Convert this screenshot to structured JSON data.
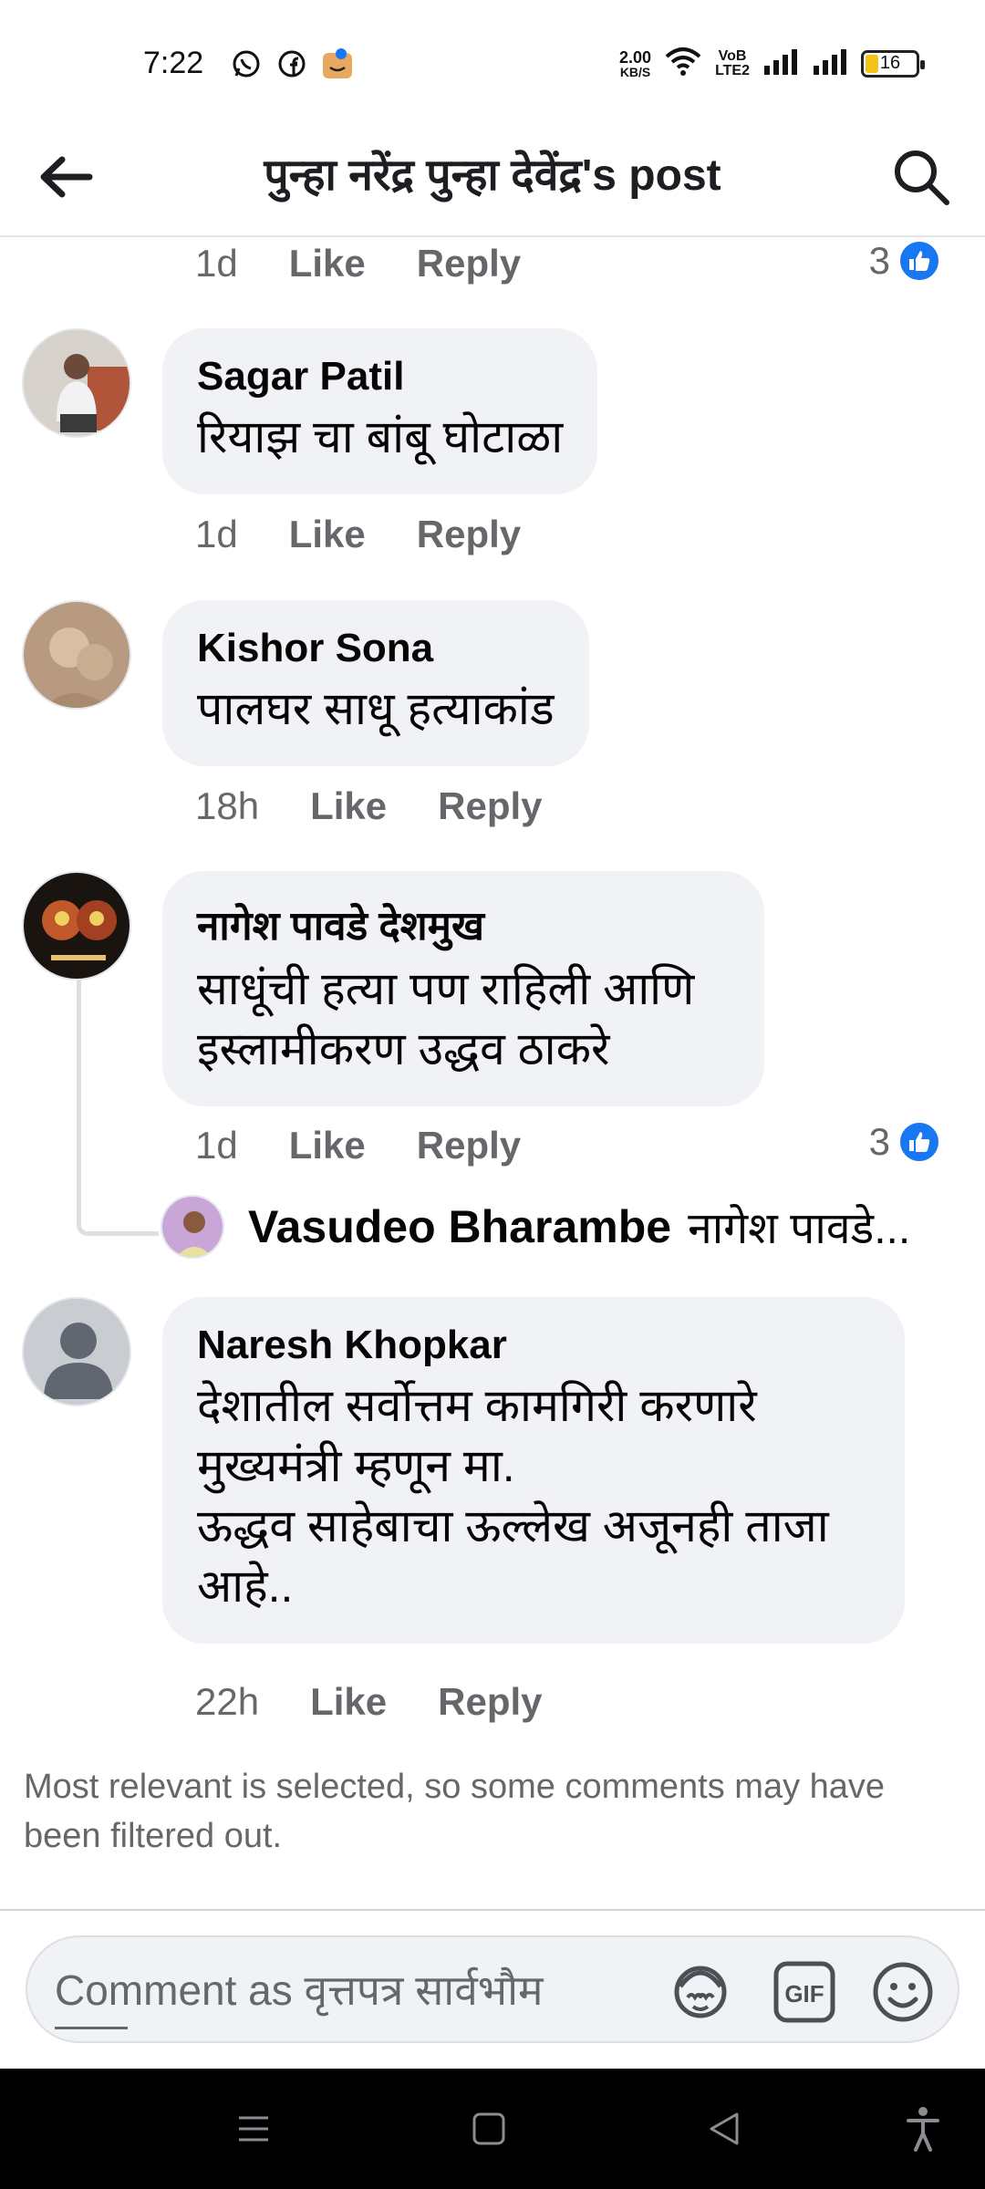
{
  "status_bar": {
    "time": "7:22",
    "net_speed_value": "2.00",
    "net_speed_unit": "KB/S",
    "volte_top": "VoB",
    "volte_bottom": "LTE2",
    "battery": "16",
    "icons": [
      "whatsapp-icon",
      "facebook-icon",
      "app-icon",
      "wifi-icon",
      "signal-icon",
      "signal-icon",
      "battery-icon"
    ]
  },
  "header": {
    "title": "पुन्हा नरेंद्र पुन्हा देवेंद्र's post",
    "back_icon": "arrow-left-icon",
    "search_icon": "search-icon"
  },
  "comments": [
    {
      "id": "top",
      "time": "1d",
      "like": "Like",
      "reply": "Reply",
      "reactions": "3"
    },
    {
      "id": "sagar",
      "author": "Sagar Patil",
      "text": "रियाझ चा बांबू घोटाळा",
      "time": "1d",
      "like": "Like",
      "reply": "Reply"
    },
    {
      "id": "kishor",
      "author": "Kishor Sona",
      "text": "पालघर साधू हत्याकांड",
      "time": "18h",
      "like": "Like",
      "reply": "Reply"
    },
    {
      "id": "nagesh",
      "author": "नागेश पावडे देशमुख",
      "text_line1": "साधूंची हत्या पण राहिली आणि",
      "text_line2": "इस्लामीकरण उद्धव ठाकरे",
      "time": "1d",
      "like": "Like",
      "reply": "Reply",
      "reactions": "3",
      "reply_preview": {
        "author": "Vasudeo Bharambe",
        "text": "नागेश पावडे..."
      }
    },
    {
      "id": "naresh",
      "author": "Naresh Khopkar",
      "text_line1": "देशातील सर्वोत्तम कामगिरी करणारे",
      "text_line2": "मुख्यमंत्री म्हणून मा.",
      "text_line3": "ऊद्धव साहेबाचा ऊल्लेख अजूनही ताजा",
      "text_line4": "आहे..",
      "time": "22h",
      "like": "Like",
      "reply": "Reply"
    }
  ],
  "filter_note": "Most relevant is selected, so some comments may have been filtered out.",
  "composer": {
    "placeholder": "Comment as वृत्तपत्र सार्वभौम",
    "icons": [
      "avatar-sticker-icon",
      "gif-icon",
      "emoji-icon"
    ]
  },
  "nav_bar": {
    "icons": [
      "menu-icon",
      "home-square-icon",
      "back-triangle-icon",
      "accessibility-icon"
    ]
  },
  "colors": {
    "bubble": "#f0f2f5",
    "accent": "#1877f2",
    "meta_text": "#65676b"
  }
}
